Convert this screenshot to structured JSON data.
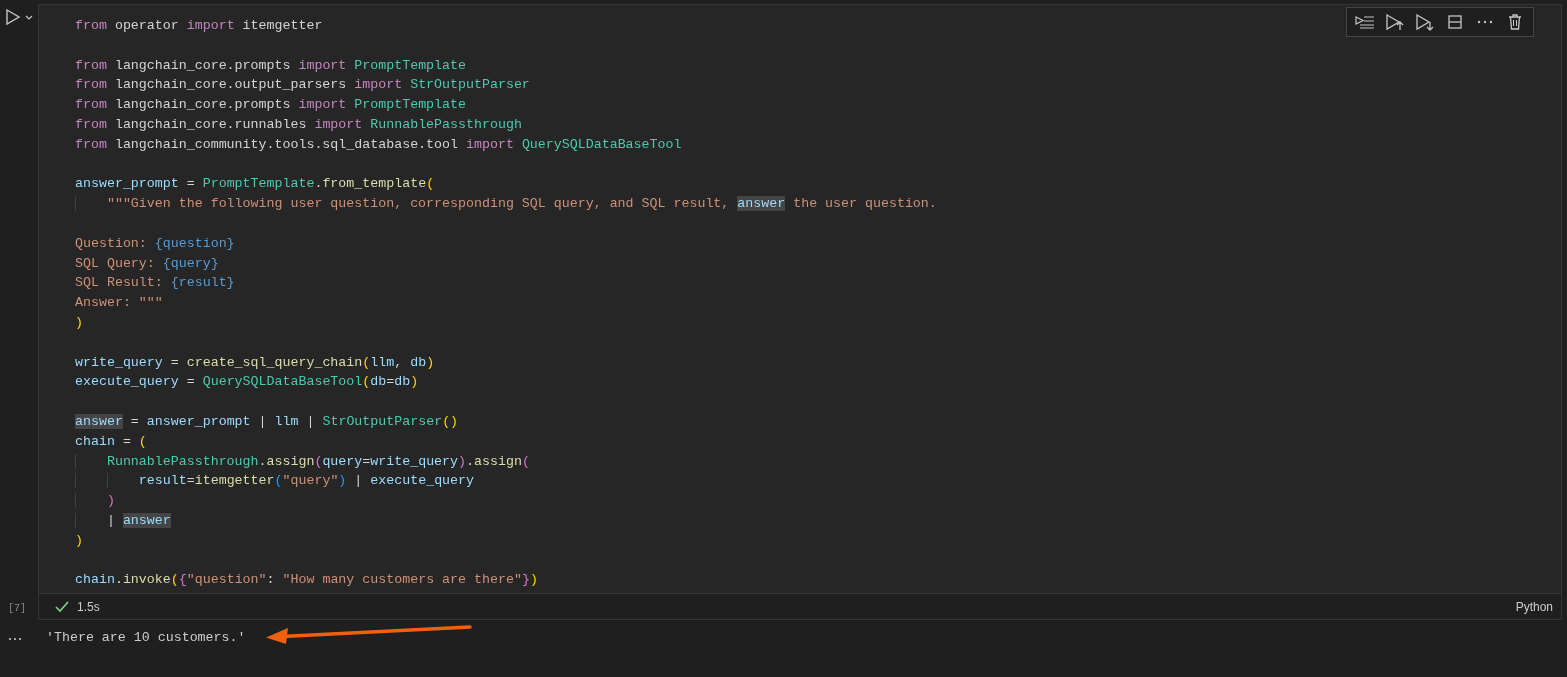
{
  "cell": {
    "execution_count": "[7]",
    "lines": [
      {
        "kind": "code",
        "tokens": [
          {
            "kind": "kw",
            "text": "from "
          },
          {
            "kind": "plain",
            "text": "operator "
          },
          {
            "kind": "kw",
            "text": "import "
          },
          {
            "kind": "plain",
            "text": "itemgetter"
          }
        ]
      },
      {
        "kind": "blank"
      },
      {
        "kind": "code",
        "tokens": [
          {
            "kind": "kw",
            "text": "from "
          },
          {
            "kind": "plain",
            "text": "langchain_core.prompts "
          },
          {
            "kind": "kw",
            "text": "import "
          },
          {
            "kind": "cls",
            "text": "PromptTemplate"
          }
        ]
      },
      {
        "kind": "code",
        "tokens": [
          {
            "kind": "kw",
            "text": "from "
          },
          {
            "kind": "plain",
            "text": "langchain_core.output_parsers "
          },
          {
            "kind": "kw",
            "text": "import "
          },
          {
            "kind": "cls",
            "text": "StrOutputParser"
          }
        ]
      },
      {
        "kind": "code",
        "tokens": [
          {
            "kind": "kw",
            "text": "from "
          },
          {
            "kind": "plain",
            "text": "langchain_core.prompts "
          },
          {
            "kind": "kw",
            "text": "import "
          },
          {
            "kind": "cls",
            "text": "PromptTemplate"
          }
        ]
      },
      {
        "kind": "code",
        "tokens": [
          {
            "kind": "kw",
            "text": "from "
          },
          {
            "kind": "plain",
            "text": "langchain_core.runnables "
          },
          {
            "kind": "kw",
            "text": "import "
          },
          {
            "kind": "cls",
            "text": "RunnablePassthrough"
          }
        ]
      },
      {
        "kind": "code",
        "tokens": [
          {
            "kind": "kw",
            "text": "from "
          },
          {
            "kind": "plain",
            "text": "langchain_community.tools.sql_database.tool "
          },
          {
            "kind": "kw",
            "text": "import "
          },
          {
            "kind": "cls",
            "text": "QuerySQLDataBaseTool"
          }
        ]
      },
      {
        "kind": "blank"
      },
      {
        "kind": "code",
        "tokens": [
          {
            "kind": "var",
            "text": "answer_prompt"
          },
          {
            "kind": "plain",
            "text": " = "
          },
          {
            "kind": "cls",
            "text": "PromptTemplate"
          },
          {
            "kind": "plain",
            "text": "."
          },
          {
            "kind": "fn",
            "text": "from_template"
          },
          {
            "kind": "b1",
            "text": "("
          }
        ]
      },
      {
        "kind": "code",
        "tokens": [
          {
            "kind": "str",
            "text": "    \"\"\"Given the following user question, corresponding SQL query, and SQL result, "
          },
          {
            "kind": "match",
            "text": "answer"
          },
          {
            "kind": "str",
            "text": " the user question."
          }
        ]
      },
      {
        "kind": "blank"
      },
      {
        "kind": "code",
        "tokens": [
          {
            "kind": "str",
            "text": "Question: "
          },
          {
            "kind": "tpl",
            "text": "{question}"
          }
        ]
      },
      {
        "kind": "code",
        "tokens": [
          {
            "kind": "str",
            "text": "SQL Query: "
          },
          {
            "kind": "tpl",
            "text": "{query}"
          }
        ]
      },
      {
        "kind": "code",
        "tokens": [
          {
            "kind": "str",
            "text": "SQL Result: "
          },
          {
            "kind": "tpl",
            "text": "{result}"
          }
        ]
      },
      {
        "kind": "code",
        "tokens": [
          {
            "kind": "str",
            "text": "Answer: \"\"\""
          }
        ]
      },
      {
        "kind": "code",
        "tokens": [
          {
            "kind": "b1",
            "text": ")"
          }
        ]
      },
      {
        "kind": "blank"
      },
      {
        "kind": "code",
        "tokens": [
          {
            "kind": "var",
            "text": "write_query"
          },
          {
            "kind": "plain",
            "text": " = "
          },
          {
            "kind": "fn",
            "text": "create_sql_query_chain"
          },
          {
            "kind": "b1",
            "text": "("
          },
          {
            "kind": "var",
            "text": "llm"
          },
          {
            "kind": "plain",
            "text": ", "
          },
          {
            "kind": "var",
            "text": "db"
          },
          {
            "kind": "b1",
            "text": ")"
          }
        ]
      },
      {
        "kind": "code",
        "tokens": [
          {
            "kind": "var",
            "text": "execute_query"
          },
          {
            "kind": "plain",
            "text": " = "
          },
          {
            "kind": "cls",
            "text": "QuerySQLDataBaseTool"
          },
          {
            "kind": "b1",
            "text": "("
          },
          {
            "kind": "var",
            "text": "db"
          },
          {
            "kind": "plain",
            "text": "="
          },
          {
            "kind": "var",
            "text": "db"
          },
          {
            "kind": "b1",
            "text": ")"
          }
        ]
      },
      {
        "kind": "blank"
      },
      {
        "kind": "code",
        "tokens": [
          {
            "kind": "match",
            "text": "answer"
          },
          {
            "kind": "plain",
            "text": " = "
          },
          {
            "kind": "var",
            "text": "answer_prompt"
          },
          {
            "kind": "plain",
            "text": " | "
          },
          {
            "kind": "var",
            "text": "llm"
          },
          {
            "kind": "plain",
            "text": " | "
          },
          {
            "kind": "cls",
            "text": "StrOutputParser"
          },
          {
            "kind": "b1",
            "text": "()"
          }
        ]
      },
      {
        "kind": "code",
        "tokens": [
          {
            "kind": "var",
            "text": "chain"
          },
          {
            "kind": "plain",
            "text": " = "
          },
          {
            "kind": "b1",
            "text": "("
          }
        ]
      },
      {
        "kind": "code",
        "tokens": [
          {
            "kind": "cls",
            "text": "    RunnablePassthrough"
          },
          {
            "kind": "plain",
            "text": "."
          },
          {
            "kind": "fn",
            "text": "assign"
          },
          {
            "kind": "b2",
            "text": "("
          },
          {
            "kind": "var",
            "text": "query"
          },
          {
            "kind": "plain",
            "text": "="
          },
          {
            "kind": "var",
            "text": "write_query"
          },
          {
            "kind": "b2",
            "text": ")"
          },
          {
            "kind": "plain",
            "text": "."
          },
          {
            "kind": "fn",
            "text": "assign"
          },
          {
            "kind": "b2",
            "text": "("
          }
        ]
      },
      {
        "kind": "code",
        "tokens": [
          {
            "kind": "var",
            "text": "        result"
          },
          {
            "kind": "plain",
            "text": "="
          },
          {
            "kind": "fn",
            "text": "itemgetter"
          },
          {
            "kind": "b3",
            "text": "("
          },
          {
            "kind": "str",
            "text": "\"query\""
          },
          {
            "kind": "b3",
            "text": ")"
          },
          {
            "kind": "plain",
            "text": " | "
          },
          {
            "kind": "var",
            "text": "execute_query"
          }
        ]
      },
      {
        "kind": "code",
        "tokens": [
          {
            "kind": "b2",
            "text": "    )"
          }
        ]
      },
      {
        "kind": "code",
        "tokens": [
          {
            "kind": "plain",
            "text": "    | "
          },
          {
            "kind": "match",
            "text": "answer"
          }
        ]
      },
      {
        "kind": "code",
        "tokens": [
          {
            "kind": "b1",
            "text": ")"
          }
        ]
      },
      {
        "kind": "blank"
      },
      {
        "kind": "code",
        "tokens": [
          {
            "kind": "var",
            "text": "chain"
          },
          {
            "kind": "plain",
            "text": "."
          },
          {
            "kind": "fn",
            "text": "invoke"
          },
          {
            "kind": "b1",
            "text": "("
          },
          {
            "kind": "b2",
            "text": "{"
          },
          {
            "kind": "str",
            "text": "\"question\""
          },
          {
            "kind": "plain",
            "text": ": "
          },
          {
            "kind": "str",
            "text": "\"How many customers are there\""
          },
          {
            "kind": "b2",
            "text": "}"
          },
          {
            "kind": "b1",
            "text": ")"
          }
        ]
      }
    ],
    "status": {
      "success": true,
      "duration": "1.5s",
      "language": "Python"
    }
  },
  "output": {
    "text": "'There are 10 customers.'"
  }
}
